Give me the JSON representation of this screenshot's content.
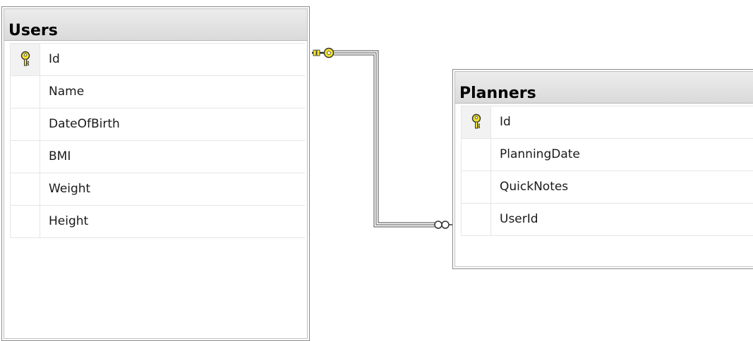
{
  "users_table": {
    "title": "Users",
    "columns": [
      {
        "name": "Id",
        "primary_key": true
      },
      {
        "name": "Name",
        "primary_key": false
      },
      {
        "name": "DateOfBirth",
        "primary_key": false
      },
      {
        "name": "BMI",
        "primary_key": false
      },
      {
        "name": "Weight",
        "primary_key": false
      },
      {
        "name": "Height",
        "primary_key": false
      }
    ]
  },
  "planners_table": {
    "title": "Planners",
    "columns": [
      {
        "name": "Id",
        "primary_key": true
      },
      {
        "name": "PlanningDate",
        "primary_key": false
      },
      {
        "name": "QuickNotes",
        "primary_key": false
      },
      {
        "name": "UserId",
        "primary_key": false
      }
    ]
  },
  "relationship": {
    "from_table": "Users",
    "to_table": "Planners",
    "from_end": "key-icon",
    "to_end": "infinity-icon"
  },
  "colors": {
    "key_yellow": "#f5e52b",
    "line": "#555555"
  }
}
